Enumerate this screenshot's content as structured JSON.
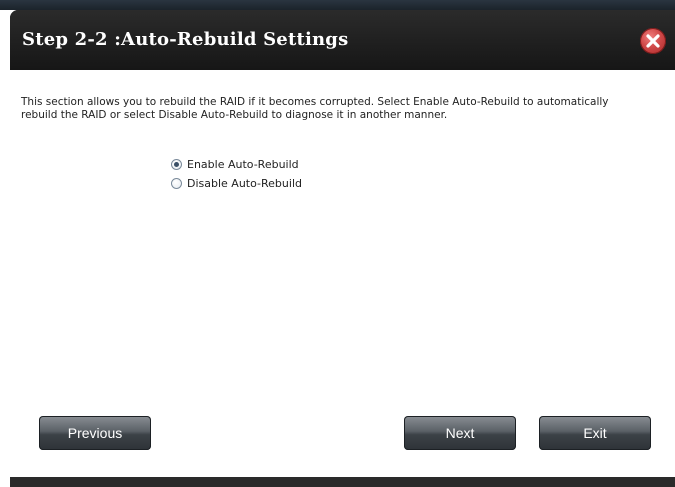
{
  "dialog": {
    "title": "Step 2-2 :Auto-Rebuild Settings",
    "close_icon": "close-x-icon"
  },
  "description": {
    "line1": "This section allows you to rebuild the RAID if it becomes corrupted. Select Enable Auto-Rebuild to automatically",
    "line2": "rebuild the RAID or select Disable Auto-Rebuild to diagnose it in another manner."
  },
  "options": [
    {
      "label": "Enable Auto-Rebuild",
      "checked": true
    },
    {
      "label": "Disable Auto-Rebuild",
      "checked": false
    }
  ],
  "buttons": {
    "previous": "Previous",
    "next": "Next",
    "exit": "Exit"
  },
  "colors": {
    "header_bg": "#1b1b1b",
    "close_button": "#d04848",
    "button_bg": "#4a5056"
  }
}
